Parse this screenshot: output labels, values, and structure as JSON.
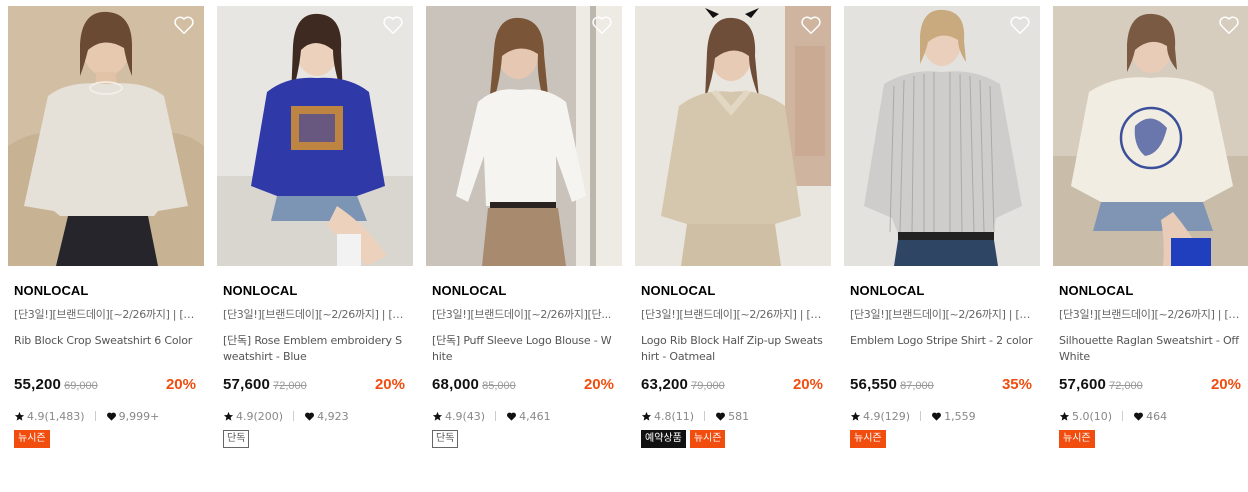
{
  "colors": {
    "discount": "#f04d0f",
    "tag_new": "#f04d0f",
    "tag_preorder": "#111111",
    "heart_outline": "#ffffff"
  },
  "products": [
    {
      "brand": "NONLOCAL",
      "promo": "[단3일!][브랜드데이][~2/26까지] | [L...",
      "title": "Rib Block Crop Sweatshirt 6 Color",
      "price": "55,200",
      "original_price": "69,000",
      "discount": "20%",
      "rating": "4.9(1,483)",
      "likes": "9,999+",
      "tags": [
        {
          "label": "뉴시즌",
          "kind": "new"
        }
      ]
    },
    {
      "brand": "NONLOCAL",
      "promo": "[단3일!][브랜드데이][~2/26까지] | [2...",
      "title": "[단독] Rose Emblem embroidery Sweatshirt - Blue",
      "price": "57,600",
      "original_price": "72,000",
      "discount": "20%",
      "rating": "4.9(200)",
      "likes": "4,923",
      "tags": [
        {
          "label": "단독",
          "kind": "excl"
        }
      ]
    },
    {
      "brand": "NONLOCAL",
      "promo": "[단3일!][브랜드데이][~2/26까지][단...",
      "title": "[단독] Puff Sleeve Logo Blouse - White",
      "price": "68,000",
      "original_price": "85,000",
      "discount": "20%",
      "rating": "4.9(43)",
      "likes": "4,461",
      "tags": [
        {
          "label": "단독",
          "kind": "excl"
        }
      ]
    },
    {
      "brand": "NONLOCAL",
      "promo": "[단3일!][브랜드데이][~2/26까지] | [2...",
      "title": "Logo Rib Block Half Zip-up Sweatshirt - Oatmeal",
      "price": "63,200",
      "original_price": "79,000",
      "discount": "20%",
      "rating": "4.8(11)",
      "likes": "581",
      "tags": [
        {
          "label": "예약상품",
          "kind": "pre"
        },
        {
          "label": "뉴시즌",
          "kind": "new"
        }
      ]
    },
    {
      "brand": "NONLOCAL",
      "promo": "[단3일!][브랜드데이][~2/26까지] | [2...",
      "title": "Emblem Logo Stripe Shirt - 2 color",
      "price": "56,550",
      "original_price": "87,000",
      "discount": "35%",
      "rating": "4.9(129)",
      "likes": "1,559",
      "tags": [
        {
          "label": "뉴시즌",
          "kind": "new"
        }
      ]
    },
    {
      "brand": "NONLOCAL",
      "promo": "[단3일!][브랜드데이][~2/26까지] | [2...",
      "title": "Silhouette Raglan Sweatshirt - Off White",
      "price": "57,600",
      "original_price": "72,000",
      "discount": "20%",
      "rating": "5.0(10)",
      "likes": "464",
      "tags": [
        {
          "label": "뉴시즌",
          "kind": "new"
        }
      ]
    }
  ]
}
